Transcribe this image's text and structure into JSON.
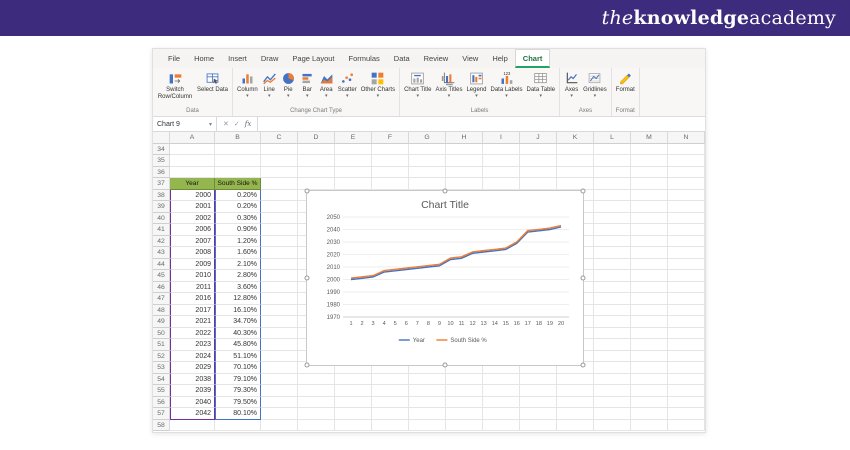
{
  "banner": {
    "the": "the",
    "knowledge": "knowledge",
    "academy": "academy"
  },
  "ribbon": {
    "tabs": [
      "File",
      "Home",
      "Insert",
      "Draw",
      "Page Layout",
      "Formulas",
      "Data",
      "Review",
      "View",
      "Help",
      "Chart"
    ],
    "active_tab": "Chart",
    "groups": [
      {
        "label": "Data",
        "buttons": [
          {
            "label": "Switch Row/Column",
            "icon": "switch-row-column-icon",
            "dropdown": false
          },
          {
            "label": "Select Data",
            "icon": "select-data-icon",
            "dropdown": false
          }
        ]
      },
      {
        "label": "Change Chart Type",
        "buttons": [
          {
            "label": "Column",
            "icon": "column-chart-icon",
            "dropdown": true
          },
          {
            "label": "Line",
            "icon": "line-chart-icon",
            "dropdown": true
          },
          {
            "label": "Pie",
            "icon": "pie-chart-icon",
            "dropdown": true
          },
          {
            "label": "Bar",
            "icon": "bar-chart-icon",
            "dropdown": true
          },
          {
            "label": "Area",
            "icon": "area-chart-icon",
            "dropdown": true
          },
          {
            "label": "Scatter",
            "icon": "scatter-chart-icon",
            "dropdown": true
          },
          {
            "label": "Other Charts",
            "icon": "other-charts-icon",
            "dropdown": true
          }
        ]
      },
      {
        "label": "Labels",
        "buttons": [
          {
            "label": "Chart Title",
            "icon": "chart-title-icon",
            "dropdown": true
          },
          {
            "label": "Axis Titles",
            "icon": "axis-titles-icon",
            "dropdown": true
          },
          {
            "label": "Legend",
            "icon": "legend-icon",
            "dropdown": true
          },
          {
            "label": "Data Labels",
            "icon": "data-labels-icon",
            "dropdown": true
          },
          {
            "label": "Data Table",
            "icon": "data-table-icon",
            "dropdown": true
          }
        ]
      },
      {
        "label": "Axes",
        "buttons": [
          {
            "label": "Axes",
            "icon": "axes-icon",
            "dropdown": true
          },
          {
            "label": "Gridlines",
            "icon": "gridlines-icon",
            "dropdown": true
          }
        ]
      },
      {
        "label": "Format",
        "buttons": [
          {
            "label": "Format",
            "icon": "format-icon",
            "dropdown": false
          }
        ]
      }
    ]
  },
  "formula_bar": {
    "name_box": "Chart 9",
    "cancel": "✕",
    "enter": "✓",
    "fx_label": "fx"
  },
  "grid": {
    "column_headers": [
      "A",
      "B",
      "C",
      "D",
      "E",
      "F",
      "G",
      "H",
      "I",
      "J",
      "K",
      "L",
      "M",
      "N"
    ],
    "row_start": 34,
    "row_end": 58
  },
  "table": {
    "header_row": 37,
    "headers": [
      "Year",
      "South Side %"
    ],
    "rows": [
      [
        "2000",
        "0.20%"
      ],
      [
        "2001",
        "0.20%"
      ],
      [
        "2002",
        "0.30%"
      ],
      [
        "2006",
        "0.90%"
      ],
      [
        "2007",
        "1.20%"
      ],
      [
        "2008",
        "1.60%"
      ],
      [
        "2009",
        "2.10%"
      ],
      [
        "2010",
        "2.80%"
      ],
      [
        "2011",
        "3.60%"
      ],
      [
        "2016",
        "12.80%"
      ],
      [
        "2017",
        "16.10%"
      ],
      [
        "2021",
        "34.70%"
      ],
      [
        "2022",
        "40.30%"
      ],
      [
        "2023",
        "45.80%"
      ],
      [
        "2024",
        "51.10%"
      ],
      [
        "2029",
        "70.10%"
      ],
      [
        "2038",
        "79.10%"
      ],
      [
        "2039",
        "79.30%"
      ],
      [
        "2040",
        "79.50%"
      ],
      [
        "2042",
        "80.10%"
      ]
    ]
  },
  "chart_data": {
    "type": "line",
    "title": "Chart Title",
    "x": [
      1,
      2,
      3,
      4,
      5,
      6,
      7,
      8,
      9,
      10,
      11,
      12,
      13,
      14,
      15,
      16,
      17,
      18,
      19,
      20
    ],
    "yticks": [
      1970,
      1980,
      1990,
      2000,
      2010,
      2020,
      2030,
      2040,
      2050
    ],
    "ylim": [
      1970,
      2050
    ],
    "grid": true,
    "legend_position": "bottom",
    "series": [
      {
        "name": "Year",
        "color": "#4472C4",
        "values": [
          2000,
          2001,
          2002,
          2006,
          2007,
          2008,
          2009,
          2010,
          2011,
          2016,
          2017,
          2021,
          2022,
          2023,
          2024,
          2029,
          2038,
          2039,
          2040,
          2042
        ]
      },
      {
        "name": "South Side %",
        "color": "#ED7D31",
        "values": [
          0.2,
          0.2,
          0.3,
          0.9,
          1.2,
          1.6,
          2.1,
          2.8,
          3.6,
          12.8,
          16.1,
          34.7,
          40.3,
          45.8,
          51.1,
          70.1,
          79.1,
          79.3,
          79.5,
          80.1
        ],
        "note": "orange line visually overlaps the Year line in the screenshot"
      }
    ]
  }
}
